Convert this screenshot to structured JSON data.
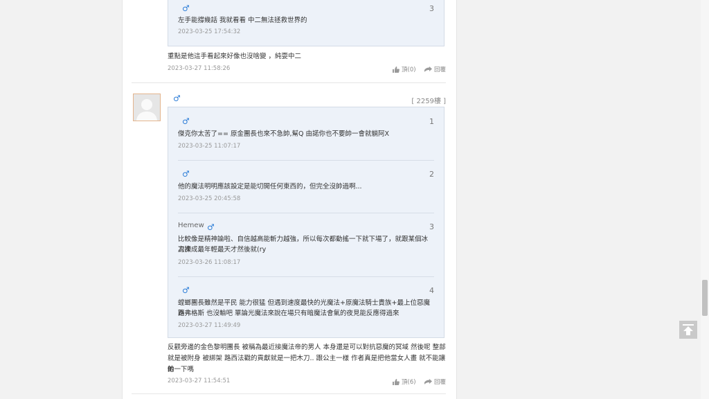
{
  "thread": {
    "prev_post": {
      "quote": {
        "number": "3",
        "text": "左手能撐幾話 我就看看 中二無法拯救世界的",
        "time": "2023-03-25 17:54:32"
      },
      "text": "重點是他這手看起來好像也沒啥變 ，純耍中二",
      "time": "2023-03-27 11:58:26",
      "like_label": "頂(0)",
      "reply_label": "回覆"
    },
    "post": {
      "floor": "[ 2259樓 ]",
      "quotes": [
        {
          "number": "1",
          "name": "",
          "text": "傑克你太苦了== 原金團長也來不急帥,幫Q 由諾你也不要帥一會就躺阿X",
          "time": "2023-03-25 11:07:17"
        },
        {
          "number": "2",
          "name": "",
          "text": "他的魔法明明應該設定是能切開任何東西的，但完全沒帥過啊...",
          "time": "2023-03-25 20:45:58"
        },
        {
          "number": "3",
          "name": "Hemew",
          "text_line1": "比較像是精神論啦、自信越高能斬力越強，所以每次都動搖一下就下場了，就跟某個冰刀次",
          "text_line2": "次捧成最年輕最天才然後就(ry",
          "time": "2023-03-26 11:08:17"
        },
        {
          "number": "4",
          "name": "",
          "text_line1": "螳螂團長雖然是平民 能力很猛 但遇到速度最快的光魔法+原魔法騎士貴族+最上位惡魔路",
          "text_line2": "西弗格斯 也沒輸吧 單論光魔法來說在場只有暗魔法會氣的夜見能反應得過來",
          "time": "2023-03-27 11:49:49"
        }
      ],
      "text_line1": "反觀旁邊的金色黎明團長 被稱為最近接魔法帝的男人 本身還是可以對抗惡魔的冥域 然後呢 整部",
      "text_line2": "就是被附身 被綁架 路西法戳的貢獻就是一把木刀.. 跟公主一樣 作者真是把他當女人畫 就不能讓他",
      "text_line3": "帥一下嗎",
      "time": "2023-03-27 11:54:51",
      "like_label": "頂(6)",
      "reply_label": "回覆"
    }
  },
  "icons": {
    "gender": "♂",
    "like": "thumbs-up-icon",
    "reply": "reply-arrow-icon",
    "top": "back-to-top-icon"
  },
  "colors": {
    "male": "#2f7fd8",
    "quote_bg": "#edf2f9",
    "quote_border": "#d3dbe6"
  }
}
